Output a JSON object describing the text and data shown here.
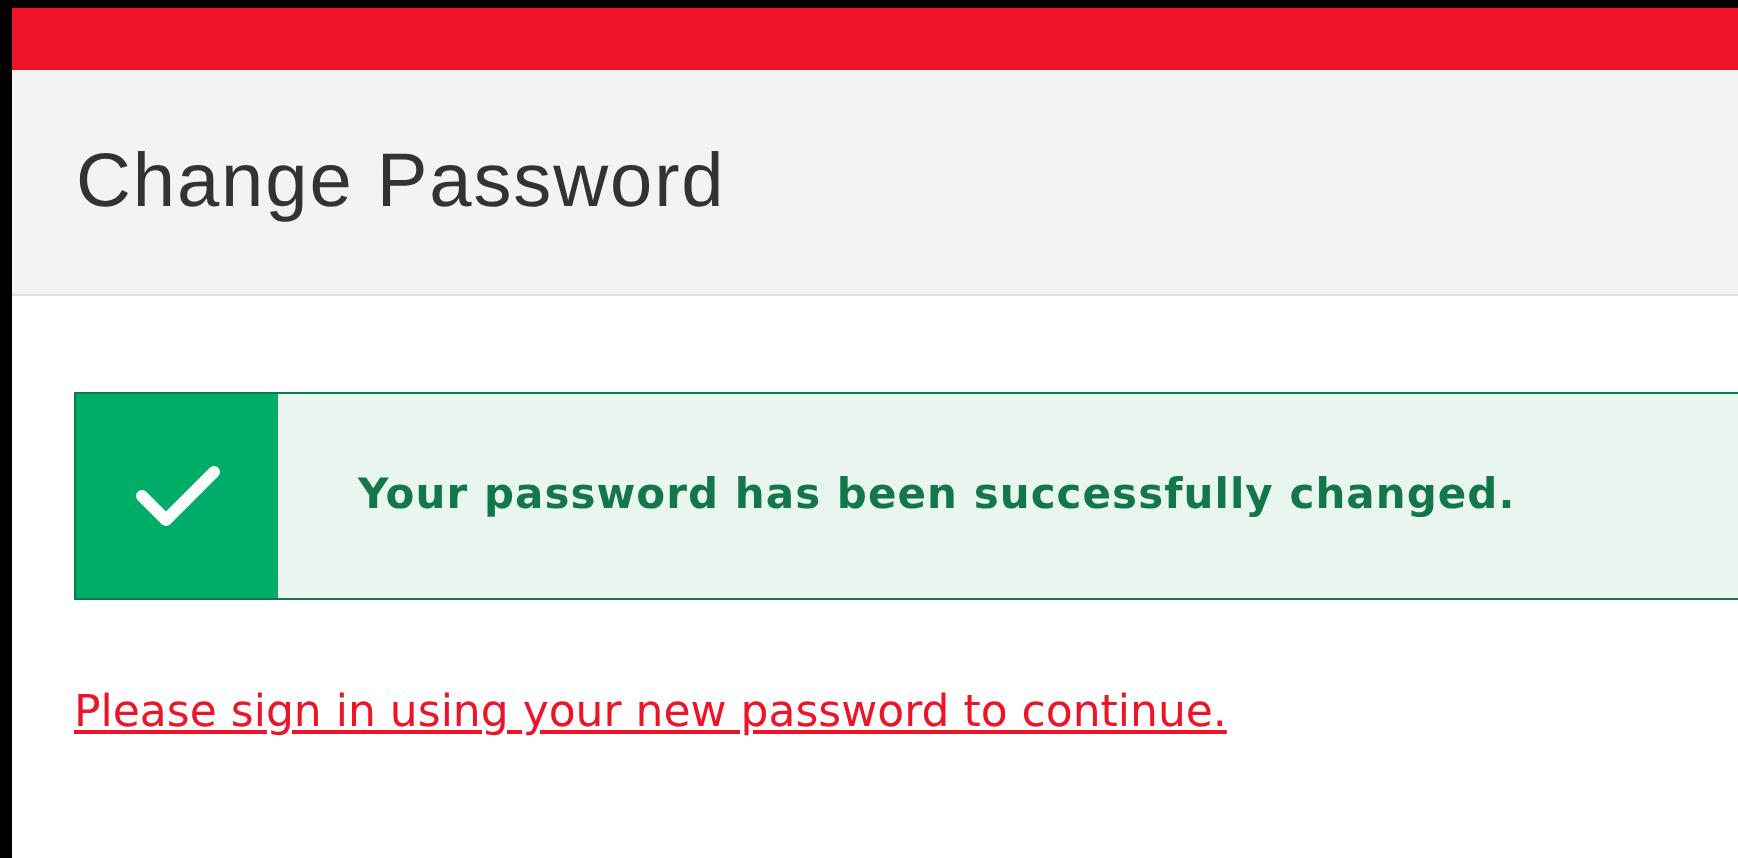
{
  "header": {
    "title": "Change Password"
  },
  "alert": {
    "kind": "success",
    "message": "Your password has been successfully changed."
  },
  "link": "Please sign in using your new password to continue."
}
